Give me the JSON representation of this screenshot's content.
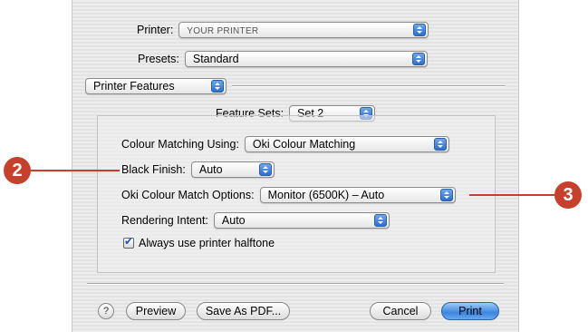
{
  "dialog": {
    "printer": {
      "label": "Printer:",
      "value": "YOUR PRINTER"
    },
    "presets": {
      "label": "Presets:",
      "value": "Standard"
    },
    "panel_select": {
      "value": "Printer Features"
    },
    "feature_sets": {
      "label": "Feature Sets:",
      "value": "Set 2"
    },
    "colour_matching": {
      "label": "Colour Matching Using:",
      "value": "Oki Colour Matching"
    },
    "black_finish": {
      "label": "Black Finish:",
      "value": "Auto"
    },
    "oki_colour_match": {
      "label": "Oki Colour Match Options:",
      "value": "Monitor (6500K) – Auto"
    },
    "rendering_intent": {
      "label": "Rendering Intent:",
      "value": "Auto"
    },
    "halftone": {
      "label": "Always use printer halftone",
      "checked": true
    },
    "buttons": {
      "help": "?",
      "preview": "Preview",
      "save_pdf": "Save As PDF...",
      "cancel": "Cancel",
      "print": "Print"
    }
  },
  "callouts": {
    "left": "2",
    "right": "3",
    "color": "#c6402b"
  }
}
